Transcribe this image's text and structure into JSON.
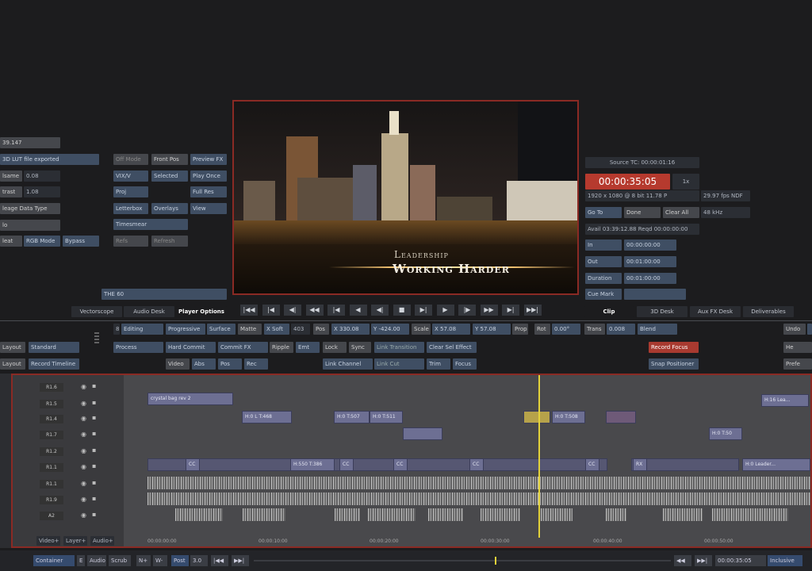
{
  "left_panel": {
    "row1": "39.147",
    "row2": "3D LUT file exported",
    "row3_label": "lsame",
    "row3_value": "0.08",
    "row4_label": "trast",
    "row4_value": "1.08",
    "row5": "leage Data Type",
    "row6": "lo",
    "row7a": "leat",
    "row7b": "RGB Mode",
    "row7c": "Bypass"
  },
  "fx_grid": {
    "c1": [
      "Off Mode",
      "VIX/V",
      "Proj",
      "Letterbox",
      "Timesmear",
      "Refs"
    ],
    "c2": [
      "Front Pos",
      "Selected",
      "",
      "Overlays",
      "",
      "Refresh"
    ],
    "c3": [
      "Preview FX",
      "Play Once",
      "Full Res",
      "View"
    ],
    "note": "THE 60"
  },
  "viewer": {
    "title_top": "Leadership",
    "title_main": "Working Harder"
  },
  "info": {
    "source_tc": "Source TC: 00:00:01:16",
    "timecode": "00:00:35:05",
    "speed": "1x",
    "format": "1920 x 1080 @ 8 bit 11.78 P",
    "fps": "29.97 fps NDF",
    "goto": "Go To",
    "done": "Done",
    "clear_all": "Clear All",
    "khz": "48 kHz",
    "avail": "Avail 03:39:12.88 Reqd 00:00:00:00",
    "in_label": "In",
    "in_val": "00:00:00:00",
    "out_label": "Out",
    "out_val": "00:01:00:00",
    "dur_label": "Duration",
    "dur_val": "00:01:00:00",
    "cue_mark": "Cue Mark"
  },
  "tabs": {
    "left": [
      "Vectorscope",
      "Audio Desk",
      "Player Options"
    ],
    "right": [
      "Clip",
      "3D Desk",
      "Aux FX Desk",
      "Deliverables"
    ]
  },
  "transport": [
    "|◀◀",
    "|◀",
    "◀|",
    "◀◀",
    "|◀",
    "◀",
    "◀|",
    "■",
    "▶|",
    "▶",
    "|▶",
    "▶▶",
    "▶|",
    "▶▶|"
  ],
  "edit_row1": {
    "a": "Editing",
    "b": "Progressive",
    "c": "Surface",
    "d": "Matte",
    "e": "X Soft",
    "f": "403",
    "g": "Pos",
    "h": "X 330.08",
    "i": "Y -424.00",
    "j": "Scale",
    "k": "X 57.08",
    "l": "Y 57.08",
    "m": "Prop",
    "n": "Rot",
    "o": "0.00°",
    "p": "Trans",
    "q": "0.008",
    "r": "Blend",
    "s": "Undo"
  },
  "edit_row2": {
    "a": "Layout",
    "b": "Standard",
    "c": "Process",
    "d": "Hard Commit",
    "e": "Commit FX",
    "f": "Ripple",
    "g": "Emt",
    "h": "Lock",
    "i": "Sync",
    "j": "Link Transition",
    "k": "Clear Sel Effect",
    "l": "Record Focus"
  },
  "edit_row3": {
    "a": "Layout",
    "b": "Record Timeline",
    "c": "Video",
    "d": "Abs",
    "e": "Pos",
    "f": "Rec",
    "g": "Link Channel",
    "h": "Link Cut",
    "i": "Trim",
    "j": "Focus",
    "k": "Snap Positioner"
  },
  "tracks": [
    "R1.6",
    "R1.5",
    "R1.4",
    "R1.7",
    "R1.2",
    "R1.1",
    "R1.1",
    "R1.9",
    "A2"
  ],
  "clips": {
    "c1": "crystal bag rev 2",
    "c2": "H:0  L  T:468",
    "c3": "H:0  T:507",
    "c4": "H:0  T:511",
    "c5": "H:0  T:508",
    "c6": "H:16  Lea...",
    "c7": "H:0  T:50",
    "c8": "H:550  T:386",
    "c9": "H:0  Leader...",
    "cc": "CC",
    "rx": "RX"
  },
  "ruler": [
    "00:00:00:00",
    "00:00:10:00",
    "00:00:20:00",
    "00:00:30:00",
    "00:00:40:00",
    "00:00:50:00"
  ],
  "track_footer": [
    "Video+",
    "Layer+",
    "Audio+"
  ],
  "bottom": {
    "container": "Container",
    "e": "E",
    "audio": "Audio",
    "scrub": "Scrub",
    "nplus": "N+",
    "w": "W-",
    "post": "Post",
    "post_val": "3.0",
    "tc": "00:00:35:05",
    "inclusive": "Inclusive"
  }
}
